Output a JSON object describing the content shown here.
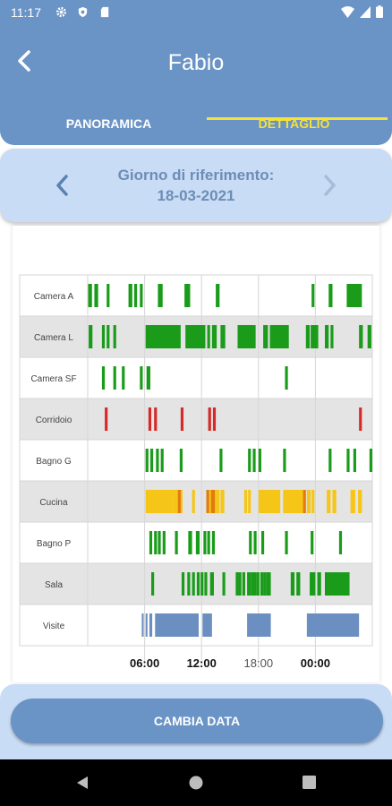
{
  "status_bar": {
    "time": "11:17",
    "left_icons": [
      "gear-icon",
      "shield-icon",
      "sd-card-icon"
    ],
    "right_icons": [
      "wifi-icon",
      "signal-icon",
      "battery-icon"
    ]
  },
  "header": {
    "title": "Fabio",
    "back_icon": "chevron-left-icon"
  },
  "tabs": [
    {
      "label": "PANORAMICA",
      "selected": false
    },
    {
      "label": "DETTAGLIO",
      "selected": true
    }
  ],
  "date_selector": {
    "label": "Giorno di riferimento:",
    "value": "18-03-2021",
    "prev_icon": "chevron-left-icon",
    "next_icon": "chevron-right-icon"
  },
  "chart_data": {
    "type": "timeline",
    "x_unit": "hour",
    "xlim": [
      0,
      30
    ],
    "ticks": [
      {
        "label": "06:00",
        "value": 6,
        "bold": true
      },
      {
        "label": "12:00",
        "value": 12,
        "bold": true
      },
      {
        "label": "18:00",
        "value": 18,
        "bold": false
      },
      {
        "label": "00:00",
        "value": 24,
        "bold": true
      }
    ],
    "colors": {
      "motion": "#1a9c1a",
      "door": "#d62a2a",
      "cooking": "#f5c518",
      "cooking_dark": "#e27a10",
      "visit": "#6b8fc0",
      "row_alt": "#e4e4e4",
      "grid": "#d6d6d6"
    },
    "rows": [
      {
        "name": "Camera A",
        "color": "motion",
        "events": [
          [
            0.05,
            0.45
          ],
          [
            0.7,
            1.1
          ],
          [
            2.0,
            2.3
          ],
          [
            4.3,
            4.7
          ],
          [
            4.9,
            5.2
          ],
          [
            5.5,
            5.8
          ],
          [
            7.4,
            7.9
          ],
          [
            10.2,
            10.8
          ],
          [
            13.5,
            13.9
          ],
          [
            23.6,
            23.9
          ],
          [
            25.4,
            25.8
          ],
          [
            27.3,
            28.9
          ],
          [
            30.1,
            30.5
          ]
        ]
      },
      {
        "name": "Camera L",
        "color": "motion",
        "events": [
          [
            0.1,
            0.5
          ],
          [
            1.5,
            1.8
          ],
          [
            2.0,
            2.3
          ],
          [
            2.7,
            3.0
          ],
          [
            6.1,
            9.8
          ],
          [
            10.3,
            12.4
          ],
          [
            12.6,
            12.9
          ],
          [
            13.1,
            13.6
          ],
          [
            14.0,
            14.5
          ],
          [
            15.8,
            17.7
          ],
          [
            18.5,
            19.0
          ],
          [
            19.2,
            21.2
          ],
          [
            23.0,
            23.4
          ],
          [
            23.5,
            24.3
          ],
          [
            25.0,
            25.4
          ],
          [
            25.6,
            25.9
          ],
          [
            28.6,
            29.0
          ],
          [
            29.5,
            29.9
          ]
        ]
      },
      {
        "name": "Camera SF",
        "color": "motion",
        "events": [
          [
            1.5,
            1.8
          ],
          [
            2.7,
            3.0
          ],
          [
            3.6,
            3.9
          ],
          [
            5.5,
            5.8
          ],
          [
            6.2,
            6.6
          ],
          [
            20.8,
            21.1
          ]
        ]
      },
      {
        "name": "Corridoio",
        "color": "door",
        "events": [
          [
            1.8,
            2.1
          ],
          [
            6.4,
            6.7
          ],
          [
            7.0,
            7.3
          ],
          [
            9.8,
            10.1
          ],
          [
            12.7,
            13.0
          ],
          [
            13.2,
            13.5
          ],
          [
            28.6,
            28.9
          ]
        ]
      },
      {
        "name": "Bagno G",
        "color": "motion",
        "events": [
          [
            6.1,
            6.4
          ],
          [
            6.6,
            6.9
          ],
          [
            7.2,
            7.5
          ],
          [
            7.7,
            8.0
          ],
          [
            9.7,
            10.0
          ],
          [
            13.9,
            14.2
          ],
          [
            16.9,
            17.2
          ],
          [
            17.4,
            17.7
          ],
          [
            18.0,
            18.3
          ],
          [
            20.6,
            20.9
          ],
          [
            25.4,
            25.7
          ],
          [
            27.3,
            27.6
          ],
          [
            28.0,
            28.3
          ],
          [
            29.7,
            30.0
          ]
        ]
      },
      {
        "name": "Cucina",
        "color": "cooking",
        "events": [
          [
            6.1,
            9.0
          ],
          [
            9.0,
            9.5
          ],
          [
            9.6,
            10.0
          ],
          [
            11.0,
            11.3
          ],
          [
            12.8,
            13.6
          ],
          [
            13.6,
            13.9
          ],
          [
            14.0,
            14.4
          ],
          [
            16.5,
            16.8
          ],
          [
            16.9,
            17.2
          ],
          [
            18.0,
            20.3
          ],
          [
            20.6,
            22.9
          ],
          [
            23.1,
            23.5
          ],
          [
            23.6,
            23.9
          ],
          [
            25.2,
            25.6
          ],
          [
            25.8,
            26.2
          ],
          [
            27.7,
            28.2
          ],
          [
            28.5,
            28.9
          ]
        ],
        "dark_events": [
          [
            9.5,
            9.8
          ],
          [
            12.5,
            12.8
          ],
          [
            13.0,
            13.4
          ],
          [
            22.7,
            23.0
          ]
        ]
      },
      {
        "name": "Bagno P",
        "color": "motion",
        "events": [
          [
            6.5,
            6.8
          ],
          [
            7.0,
            7.3
          ],
          [
            7.4,
            7.7
          ],
          [
            7.9,
            8.2
          ],
          [
            9.2,
            9.5
          ],
          [
            10.6,
            11.0
          ],
          [
            11.4,
            11.8
          ],
          [
            12.2,
            12.5
          ],
          [
            12.6,
            12.9
          ],
          [
            13.1,
            13.4
          ],
          [
            17.0,
            17.3
          ],
          [
            17.5,
            17.8
          ],
          [
            18.3,
            18.6
          ],
          [
            20.8,
            21.1
          ],
          [
            23.5,
            23.8
          ],
          [
            26.5,
            26.8
          ]
        ]
      },
      {
        "name": "Sala",
        "color": "motion",
        "events": [
          [
            6.7,
            7.0
          ],
          [
            9.9,
            10.2
          ],
          [
            10.5,
            10.8
          ],
          [
            11.0,
            11.3
          ],
          [
            11.5,
            11.8
          ],
          [
            11.9,
            12.2
          ],
          [
            12.3,
            12.6
          ],
          [
            12.9,
            13.3
          ],
          [
            14.2,
            14.5
          ],
          [
            15.6,
            15.9
          ],
          [
            15.9,
            16.2
          ],
          [
            16.3,
            16.6
          ],
          [
            16.8,
            17.2
          ],
          [
            17.2,
            17.5
          ],
          [
            17.5,
            17.8
          ],
          [
            17.8,
            18.1
          ],
          [
            18.2,
            18.5
          ],
          [
            18.5,
            18.8
          ],
          [
            18.8,
            19.3
          ],
          [
            21.4,
            21.8
          ],
          [
            22.0,
            22.4
          ],
          [
            23.4,
            24.0
          ],
          [
            24.2,
            24.6
          ],
          [
            25.0,
            27.6
          ]
        ]
      },
      {
        "name": "Visite",
        "color": "visit",
        "events": [
          [
            5.7,
            5.9
          ],
          [
            6.1,
            6.3
          ],
          [
            6.5,
            6.8
          ],
          [
            7.1,
            11.7
          ],
          [
            12.1,
            13.1
          ],
          [
            16.8,
            19.3
          ],
          [
            23.1,
            28.6
          ]
        ]
      }
    ]
  },
  "action_button": {
    "label": "CAMBIA DATA"
  },
  "system_nav": {
    "icons": [
      "back-triangle-icon",
      "home-circle-icon",
      "recents-square-icon"
    ]
  }
}
